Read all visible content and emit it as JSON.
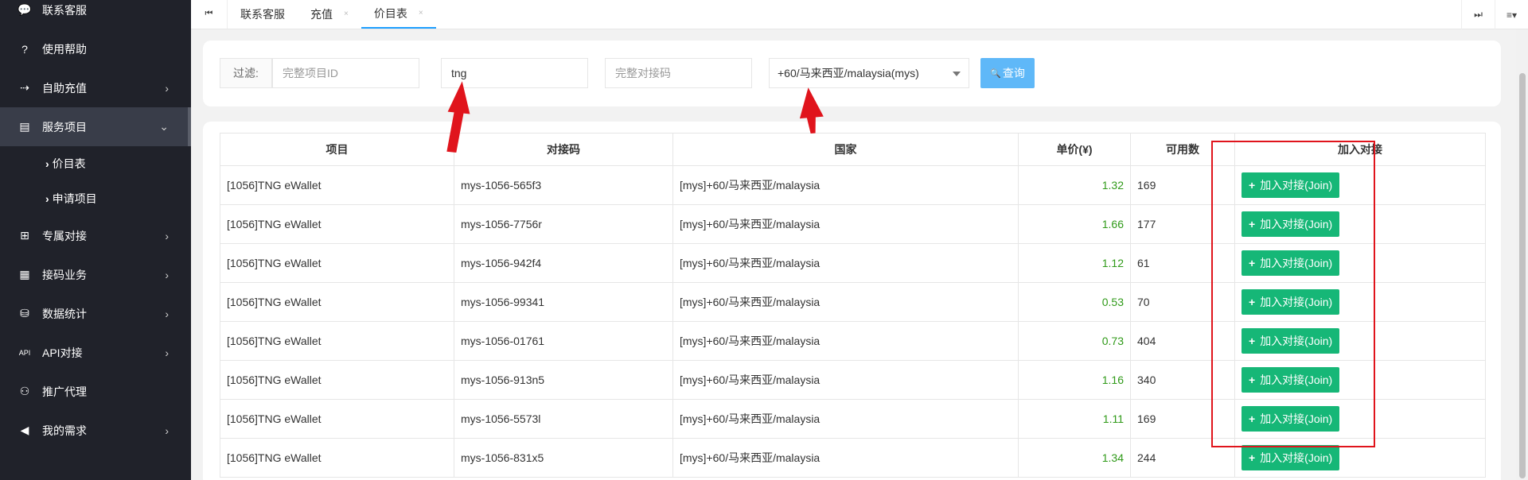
{
  "sidebar": {
    "items": [
      {
        "icon": "chat-icon",
        "glyph": "💬",
        "label": "联系客服",
        "arrow": false
      },
      {
        "icon": "help-icon",
        "glyph": "?",
        "label": "使用帮助",
        "arrow": false
      },
      {
        "icon": "recharge-icon",
        "glyph": "⇢",
        "label": "自助充值",
        "arrow": true
      },
      {
        "icon": "service-icon",
        "glyph": "▤",
        "label": "服务项目",
        "arrow": true,
        "active": true
      },
      {
        "icon": "dedicated-icon",
        "glyph": "⊞",
        "label": "专属对接",
        "arrow": true
      },
      {
        "icon": "sms-icon",
        "glyph": "▦",
        "label": "接码业务",
        "arrow": true
      },
      {
        "icon": "stats-icon",
        "glyph": "⛁",
        "label": "数据统计",
        "arrow": true
      },
      {
        "icon": "api-icon",
        "glyph": "API",
        "label": "API对接",
        "arrow": true
      },
      {
        "icon": "sitemap-icon",
        "glyph": "⚇",
        "label": "推广代理",
        "arrow": false
      },
      {
        "icon": "megaphone-icon",
        "glyph": "◀",
        "label": "我的需求",
        "arrow": true
      }
    ],
    "sub_items": [
      "价目表",
      "申请项目"
    ]
  },
  "tabs": {
    "items": [
      {
        "label": "联系客服",
        "closable": false
      },
      {
        "label": "充值",
        "closable": true
      },
      {
        "label": "价目表",
        "closable": true,
        "active": true
      }
    ],
    "close_glyph": "×"
  },
  "filter": {
    "label": "过滤:",
    "project_id_placeholder": "完整项目ID",
    "keyword_value": "tng",
    "code_placeholder": "完整对接码",
    "country_selected": "+60/马来西亚/malaysia(mys)",
    "query_label": "查询"
  },
  "table": {
    "headers": [
      "项目",
      "对接码",
      "国家",
      "单价(¥)",
      "可用数",
      "加入对接"
    ],
    "join_label": "加入对接(Join)",
    "rows": [
      {
        "project": "[1056]TNG eWallet",
        "code": "mys-1056-565f3",
        "country": "[mys]+60/马来西亚/malaysia",
        "price": "1.32",
        "available": "169"
      },
      {
        "project": "[1056]TNG eWallet",
        "code": "mys-1056-7756r",
        "country": "[mys]+60/马来西亚/malaysia",
        "price": "1.66",
        "available": "177"
      },
      {
        "project": "[1056]TNG eWallet",
        "code": "mys-1056-942f4",
        "country": "[mys]+60/马来西亚/malaysia",
        "price": "1.12",
        "available": "61"
      },
      {
        "project": "[1056]TNG eWallet",
        "code": "mys-1056-99341",
        "country": "[mys]+60/马来西亚/malaysia",
        "price": "0.53",
        "available": "70"
      },
      {
        "project": "[1056]TNG eWallet",
        "code": "mys-1056-01761",
        "country": "[mys]+60/马来西亚/malaysia",
        "price": "0.73",
        "available": "404"
      },
      {
        "project": "[1056]TNG eWallet",
        "code": "mys-1056-913n5",
        "country": "[mys]+60/马来西亚/malaysia",
        "price": "1.16",
        "available": "340"
      },
      {
        "project": "[1056]TNG eWallet",
        "code": "mys-1056-5573l",
        "country": "[mys]+60/马来西亚/malaysia",
        "price": "1.11",
        "available": "169"
      },
      {
        "project": "[1056]TNG eWallet",
        "code": "mys-1056-831x5",
        "country": "[mys]+60/马来西亚/malaysia",
        "price": "1.34",
        "available": "244"
      }
    ]
  },
  "colors": {
    "sidebar_bg": "#20222a",
    "active_tab": "#1e9fff",
    "join_button": "#16b777",
    "price_text": "#2f9a18",
    "query_button": "#5fb8f8",
    "annotation": "#e0141c"
  }
}
